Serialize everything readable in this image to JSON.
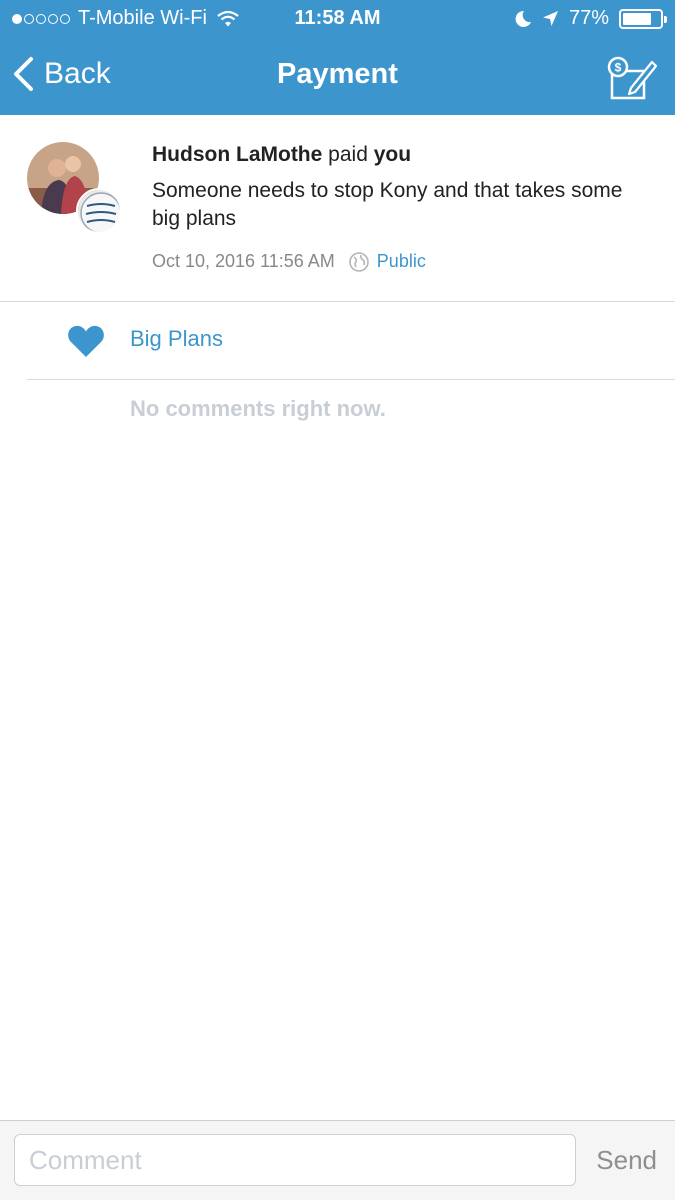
{
  "status_bar": {
    "carrier": "T-Mobile Wi-Fi",
    "time": "11:58 AM",
    "battery": "77%",
    "battery_level": 0.77
  },
  "nav": {
    "back_label": "Back",
    "title": "Payment"
  },
  "story": {
    "actor": "Hudson LaMothe",
    "verb": "paid",
    "target": "you",
    "message": "Someone needs to stop Kony and that takes some big plans",
    "timestamp": "Oct 10, 2016 11:56 AM",
    "audience": "Public"
  },
  "likes": {
    "names": "Big Plans"
  },
  "comments": {
    "empty_text": "No comments right now."
  },
  "comment_bar": {
    "placeholder": "Comment",
    "send_label": "Send"
  },
  "colors": {
    "brand": "#3d95ce",
    "muted": "#c7ced5"
  }
}
